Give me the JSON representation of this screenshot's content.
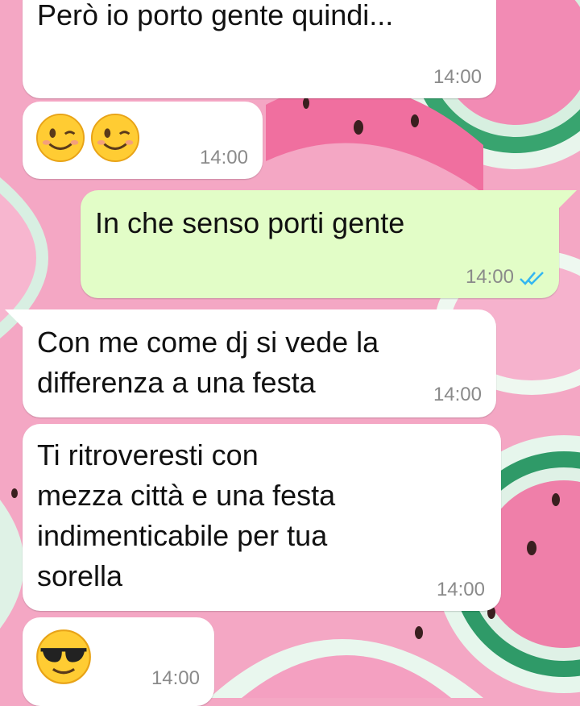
{
  "messages": [
    {
      "id": "m1",
      "direction": "incoming",
      "text": "Però io porto gente quindi...",
      "time": "14:00"
    },
    {
      "id": "m2",
      "direction": "incoming",
      "emojis": [
        "winking-face",
        "winking-face"
      ],
      "time": "14:00"
    },
    {
      "id": "m3",
      "direction": "outgoing",
      "text": "In che senso porti gente",
      "time": "14:00",
      "status": "read"
    },
    {
      "id": "m4",
      "direction": "incoming",
      "text": "Con me come dj si vede la\ndifferenza a una festa",
      "time": "14:00"
    },
    {
      "id": "m5",
      "direction": "incoming",
      "text": "Ti ritroveresti con\nmezza città e una festa\nindimenticabile per tua\nsorella",
      "time": "14:00"
    },
    {
      "id": "m6",
      "direction": "incoming",
      "emojis": [
        "smiling-face-with-sunglasses"
      ],
      "time": "14:00"
    }
  ],
  "colors": {
    "incoming_bubble": "#ffffff",
    "outgoing_bubble": "#e2fdc7",
    "read_ticks": "#34b7f1",
    "wallpaper_pink": "#f4a7c4",
    "wallpaper_rind": "#2e9a6a"
  }
}
